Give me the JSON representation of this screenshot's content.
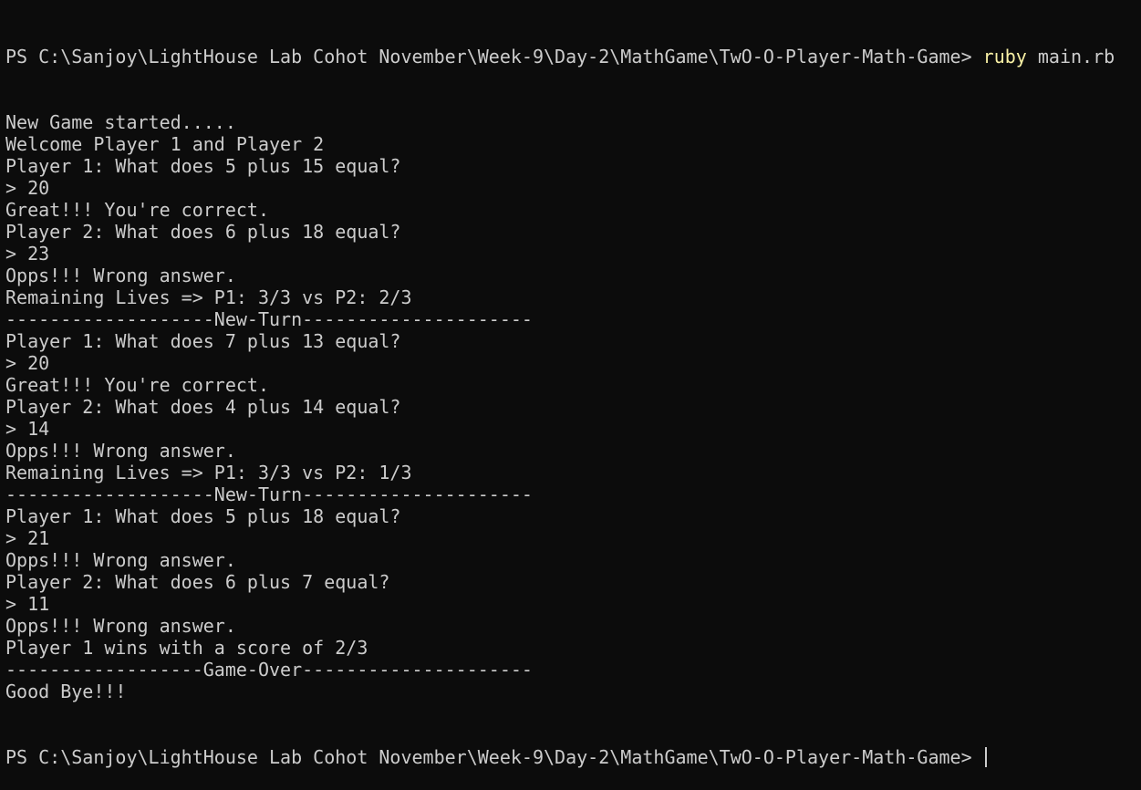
{
  "terminal": {
    "prompt_path": "PS C:\\Sanjoy\\LightHouse Lab Cohot November\\Week-9\\Day-2\\MathGame\\TwO-O-Player-Math-Game> ",
    "command_name": "ruby",
    "command_args": " main.rb",
    "output_lines": [
      "New Game started.....",
      "Welcome Player 1 and Player 2",
      "Player 1: What does 5 plus 15 equal?",
      "> 20",
      "Great!!! You're correct.",
      "Player 2: What does 6 plus 18 equal?",
      "> 23",
      "Opps!!! Wrong answer.",
      "Remaining Lives => P1: 3/3 vs P2: 2/3",
      "-------------------New-Turn---------------------",
      "Player 1: What does 7 plus 13 equal?",
      "> 20",
      "Great!!! You're correct.",
      "Player 2: What does 4 plus 14 equal?",
      "> 14",
      "Opps!!! Wrong answer.",
      "Remaining Lives => P1: 3/3 vs P2: 1/3",
      "-------------------New-Turn---------------------",
      "Player 1: What does 5 plus 18 equal?",
      "> 21",
      "Opps!!! Wrong answer.",
      "Player 2: What does 6 plus 7 equal?",
      "> 11",
      "Opps!!! Wrong answer.",
      "Player 1 wins with a score of 2/3",
      "------------------Game-Over---------------------",
      "Good Bye!!!"
    ],
    "final_prompt": "PS C:\\Sanjoy\\LightHouse Lab Cohot November\\Week-9\\Day-2\\MathGame\\TwO-O-Player-Math-Game> "
  },
  "colors": {
    "background": "#0c0c0c",
    "text": "#cccccc",
    "command": "#f9f1a5"
  }
}
